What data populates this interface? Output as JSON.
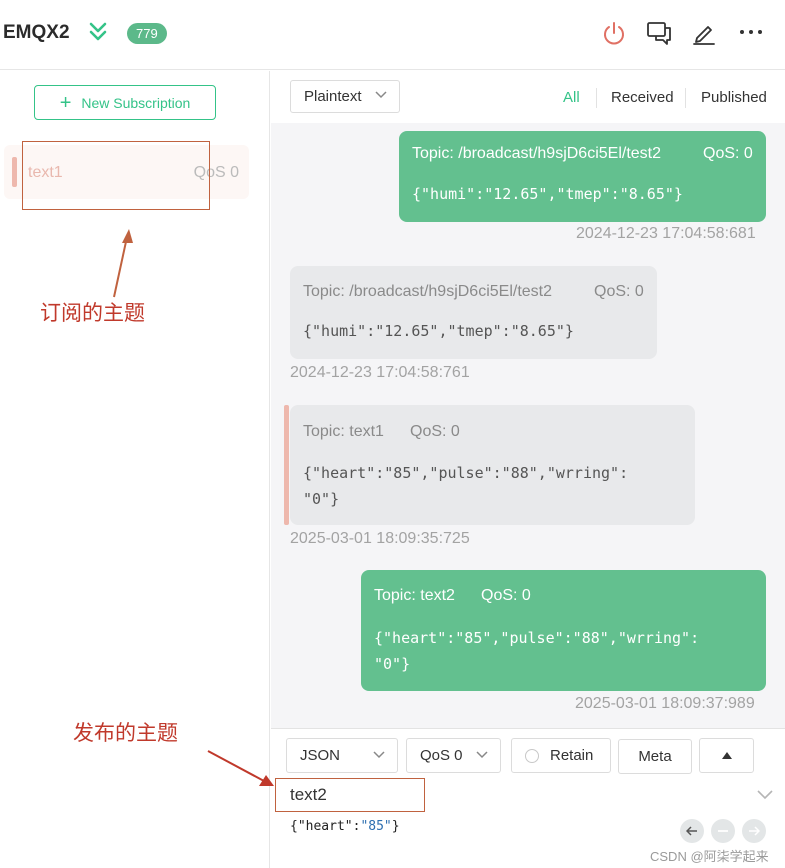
{
  "header": {
    "connection_name": "EMQX2",
    "message_count": "779",
    "icons": [
      "collapse-chevron-icon",
      "power-icon",
      "chat-icon",
      "edit-icon",
      "more-icon"
    ],
    "colors": {
      "accent": "#34c388",
      "sent_bubble": "#63c08f",
      "badge": "#5cb98a"
    }
  },
  "sidebar": {
    "new_subscription_label": "New Subscription",
    "subscriptions": [
      {
        "topic": "text1",
        "qos": "QoS 0",
        "color": "#eeb8ad"
      }
    ]
  },
  "annotations": {
    "subscribed_topic": "订阅的主题",
    "published_topic": "发布的主题"
  },
  "toolbar": {
    "format": "Plaintext",
    "filters": [
      "All",
      "Received",
      "Published"
    ],
    "active_filter": "All"
  },
  "messages": [
    {
      "direction": "sent",
      "topic": "Topic: /broadcast/h9sjD6ci5El/test2",
      "qos": "QoS: 0",
      "payload": "{\"humi\":\"12.65\",\"tmep\":\"8.65\"}",
      "time": "2024-12-23 17:04:58:681"
    },
    {
      "direction": "received",
      "topic": "Topic: /broadcast/h9sjD6ci5El/test2",
      "qos": "QoS: 0",
      "payload": "{\"humi\":\"12.65\",\"tmep\":\"8.65\"}",
      "time": "2024-12-23 17:04:58:761"
    },
    {
      "direction": "received",
      "topic": "Topic: text1",
      "qos": "QoS: 0",
      "payload": "{\"heart\":\"85\",\"pulse\":\"88\",\"wrring\":\n\"0\"}",
      "time": "2025-03-01 18:09:35:725"
    },
    {
      "direction": "sent",
      "topic": "Topic: text2",
      "qos": "QoS: 0",
      "payload": "{\"heart\":\"85\",\"pulse\":\"88\",\"wrring\":\n\"0\"}",
      "time": "2025-03-01 18:09:37:989"
    }
  ],
  "publish": {
    "payload_format": "JSON",
    "qos": "QoS 0",
    "retain_label": "Retain",
    "meta_label": "Meta",
    "topic": "text2",
    "payload_key": "{\"heart\":",
    "payload_value": "\"85\"",
    "payload_close": "}"
  },
  "watermark": "CSDN @阿柒学起来"
}
